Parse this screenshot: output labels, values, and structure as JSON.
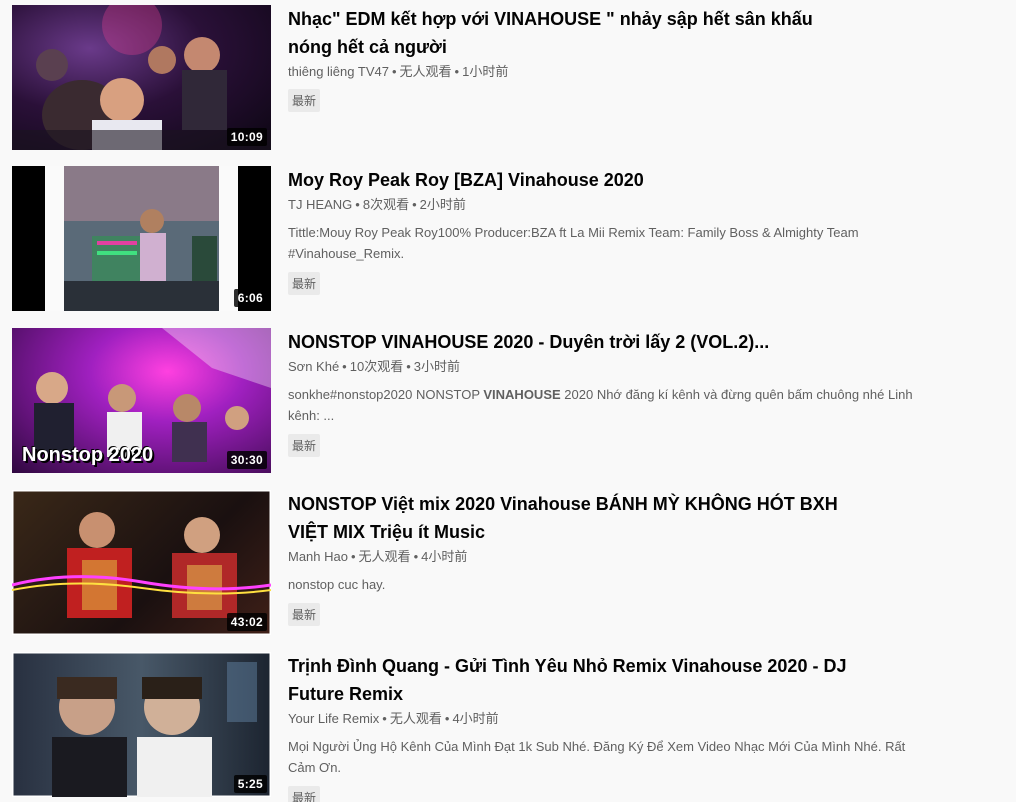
{
  "videos": [
    {
      "title": "Nhạc\" EDM kết hợp với VINAHOUSE \" nhảy sập hết sân khấu nóng hết cả người",
      "channel": "thiêng liêng TV47",
      "views": "无人观看",
      "age": "1小时前",
      "description_pre": "",
      "description_bold": "",
      "description_post": "",
      "badge": "最新",
      "duration": "10:09"
    },
    {
      "title": "Moy Roy Peak Roy [BZA] Vinahouse 2020",
      "channel": "TJ HEANG",
      "views": "8次观看",
      "age": "2小时前",
      "description_pre": "Tittle:Mouy Roy Peak Roy100% Producer:BZA ft La Mii Remix Team: Family Boss & Almighty Team #Vinahouse_Remix.",
      "description_bold": "",
      "description_post": "",
      "badge": "最新",
      "duration": "6:06"
    },
    {
      "title": "NONSTOP VINAHOUSE 2020 - Duyên trời lấy 2 (VOL.2)...",
      "channel": "Sơn Khé",
      "views": "10次观看",
      "age": "3小时前",
      "description_pre": "sonkhe#nonstop2020 NONSTOP ",
      "description_bold": "VINAHOUSE",
      "description_post": " 2020 Nhớ đăng kí kênh và đừng quên bấm chuông nhé Linh kênh: ...",
      "badge": "最新",
      "duration": "30:30",
      "overlay_text": "Nonstop 2020"
    },
    {
      "title": "NONSTOP Việt mix 2020 Vinahouse BÁNH MỲ KHÔNG HÓT BXH VIỆT MIX Triệu ít Music",
      "channel": "Manh Hao",
      "views": "无人观看",
      "age": "4小时前",
      "description_pre": "nonstop cuc hay.",
      "description_bold": "",
      "description_post": "",
      "badge": "最新",
      "duration": "43:02"
    },
    {
      "title": "Trịnh Đình Quang - Gửi Tình Yêu Nhỏ Remix Vinahouse 2020 - DJ Future Remix",
      "channel": "Your Life Remix",
      "views": "无人观看",
      "age": "4小时前",
      "description_pre": "Mọi Người Ủng Hộ Kênh Của Mình Đạt 1k Sub Nhé. Đăng Ký Để Xem Video Nhạc Mới Của Mình Nhé. Rất Cảm Ơn.",
      "description_bold": "",
      "description_post": "",
      "badge": "最新",
      "duration": "5:25"
    }
  ],
  "colors": {
    "background": "#f9f9f9",
    "title": "#030303",
    "meta": "#606060",
    "badge_bg": "#eaeaea"
  }
}
